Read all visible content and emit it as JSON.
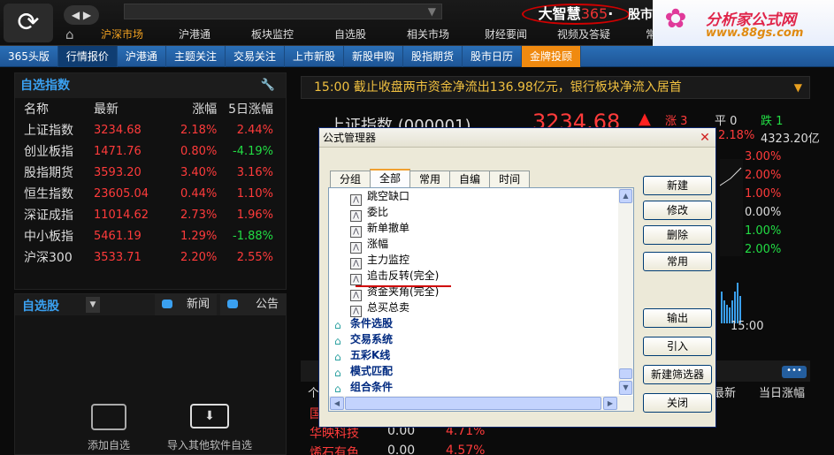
{
  "header": {
    "search_dropdown": "▼",
    "brand_main": "大智慧",
    "brand_num": "365",
    "brand_dot": "·",
    "brand_suffix": "股市",
    "main_nav": [
      "沪深市场",
      "沪港通",
      "板块监控",
      "自选股",
      "相关市场",
      "财经要闻",
      "视频及答疑",
      "常用工"
    ]
  },
  "watermark": {
    "title": "分析家公式网",
    "url": "www.88gs.com"
  },
  "sub_nav": [
    "365头版",
    "行情报价",
    "沪港通",
    "主题关注",
    "交易关注",
    "上市新股",
    "新股申购",
    "股指期货",
    "股市日历",
    "金牌投顾"
  ],
  "index_panel": {
    "title": "自选指数",
    "columns": [
      "名称",
      "最新",
      "涨幅",
      "5日涨幅"
    ],
    "rows": [
      {
        "name": "上证指数",
        "last": "3234.68",
        "chg": "2.18%",
        "chg5": "2.44%",
        "dir5": "up"
      },
      {
        "name": "创业板指",
        "last": "1471.76",
        "chg": "0.80%",
        "chg5": "-4.19%",
        "dir5": "down"
      },
      {
        "name": "股指期货",
        "last": "3593.20",
        "chg": "3.40%",
        "chg5": "3.16%",
        "dir5": "up"
      },
      {
        "name": "恒生指数",
        "last": "23605.04",
        "chg": "0.44%",
        "chg5": "1.10%",
        "dir5": "up"
      },
      {
        "name": "深证成指",
        "last": "11014.62",
        "chg": "2.73%",
        "chg5": "1.96%",
        "dir5": "up"
      },
      {
        "name": "中小板指",
        "last": "5461.19",
        "chg": "1.29%",
        "chg5": "-1.88%",
        "dir5": "down"
      },
      {
        "name": "沪深300",
        "last": "3533.71",
        "chg": "2.20%",
        "chg5": "2.55%",
        "dir5": "up"
      }
    ]
  },
  "watchlist": {
    "title": "自选股",
    "news_tab": "新闻",
    "announce_tab": "公告",
    "add_label": "添加自选",
    "import_label": "导入其他软件自选"
  },
  "ticker": {
    "text": "15:00 截止收盘两市资金净流出136.98亿元，银行板块净流入居首"
  },
  "sh_index": {
    "name": "上证指数",
    "code": "(000001)",
    "price": "3234.68",
    "up_label": "涨",
    "up_count": "3",
    "flat_label": "平",
    "flat_count": "0",
    "down_label": "跌",
    "down_count": "1",
    "pct": "2.18%",
    "amount": "4323.20亿",
    "axis_labels": [
      {
        "text": "3.00%",
        "color": "#ff3b3b"
      },
      {
        "text": "2.00%",
        "color": "#ff3b3b"
      },
      {
        "text": "1.00%",
        "color": "#ff3b3b"
      },
      {
        "text": "0.00%",
        "color": "#dddddd"
      },
      {
        "text": "1.00%",
        "color": "#22dd44"
      },
      {
        "text": "2.00%",
        "color": "#22dd44"
      }
    ],
    "time": "15:00"
  },
  "stock_list": {
    "col_name": "个",
    "col_latest": "最新",
    "col_chg": "当日涨幅",
    "more": "•••",
    "rows": [
      {
        "name": "国",
        "a": "",
        "b": ""
      },
      {
        "name": "华映科技",
        "a": "0.00",
        "b": "4.71%"
      },
      {
        "name": "烯石有色",
        "a": "0.00",
        "b": "4.57%"
      }
    ]
  },
  "dialog": {
    "title": "公式管理器",
    "tabs": [
      "分组",
      "全部",
      "常用",
      "自编",
      "时间"
    ],
    "active_tab": "全部",
    "tree_leaves": [
      "跳空缺口",
      "委比",
      "新单撤单",
      "涨幅",
      "主力监控",
      "追击反转(完全)",
      "资金夹角(完全)",
      "总买总卖"
    ],
    "tree_groups": [
      "条件选股",
      "交易系统",
      "五彩K线",
      "模式匹配",
      "组合条件"
    ],
    "buttons": [
      "新建",
      "修改",
      "删除",
      "常用",
      "输出",
      "引入",
      "新建筛选器",
      "关闭"
    ]
  },
  "colors": {
    "up": "#ff3b3b",
    "down": "#22dd44",
    "accent_blue": "#3aa0f0",
    "subnav_bg": "#2a6fb7",
    "gold_tab": "#f08a10"
  }
}
